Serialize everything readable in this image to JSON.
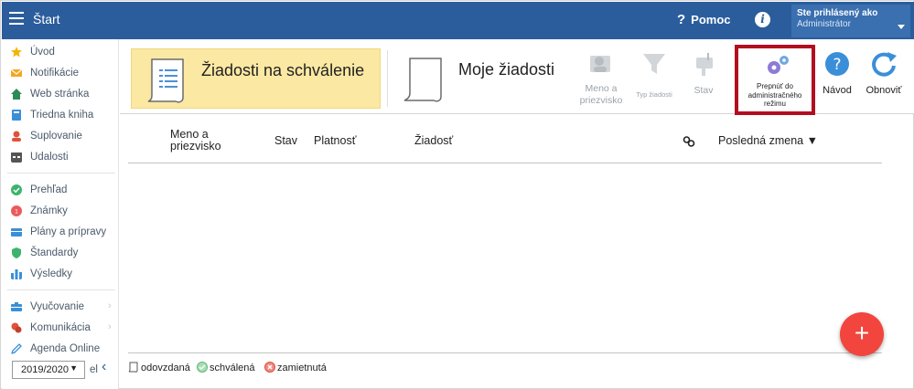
{
  "header": {
    "app_title": "Štart",
    "help_label": "Pomoc",
    "help_symbol": "?",
    "info_symbol": "i",
    "user_line1": "Ste prihlásený ako",
    "user_line2": "Administrátor",
    "bar_color": "#2b5d9c"
  },
  "sidebar": {
    "items": [
      {
        "label": "Úvod",
        "icon": "star-icon",
        "color": "#f4b400"
      },
      {
        "label": "Notifikácie",
        "icon": "envelope-icon",
        "color": "#f5a623"
      },
      {
        "label": "Web stránka",
        "icon": "home-icon",
        "color": "#2e8b57"
      },
      {
        "label": "Triedna kniha",
        "icon": "book-icon",
        "color": "#3a8fd8"
      },
      {
        "label": "Suplovanie",
        "icon": "person-swap-icon",
        "color": "#e0533b"
      },
      {
        "label": "Udalosti",
        "icon": "calendar-icon",
        "color": "#555555"
      },
      {
        "label": "Prehľad",
        "icon": "check-circle-icon",
        "color": "#3cb46e"
      },
      {
        "label": "Známky",
        "icon": "grade-icon",
        "color": "#ea5b5b"
      },
      {
        "label": "Plány a prípravy",
        "icon": "plan-icon",
        "color": "#3a8fd8"
      },
      {
        "label": "Štandardy",
        "icon": "shield-icon",
        "color": "#3cb46e"
      },
      {
        "label": "Výsledky",
        "icon": "bar-chart-icon",
        "color": "#3a8fd8"
      },
      {
        "label": "Vyučovanie",
        "icon": "briefcase-icon",
        "color": "#3a8fd8"
      },
      {
        "label": "Komunikácia",
        "icon": "chat-icon",
        "color": "#e0533b"
      },
      {
        "label": "Agenda Online",
        "icon": "pen-icon",
        "color": "#3a8fd8"
      }
    ],
    "chevron": "›",
    "school_year": "2019/2020",
    "year_caret": "▼",
    "collapse_text": "el",
    "collapse_chevron": "‹"
  },
  "toolbar": {
    "tab_pending": "Žiadosti na schválenie",
    "tab_mine": "Moje žiadosti",
    "tools": {
      "name_label_1": "Meno a",
      "name_label_2": "priezvisko",
      "type_label": "Typ žiadosti",
      "state_label": "Stav",
      "admin_label_1": "Prepnúť do",
      "admin_label_2": "administračného",
      "admin_label_3": "režimu",
      "guide_label": "Návod",
      "refresh_label": "Obnoviť"
    },
    "highlight_color": "#fbe8a3",
    "admin_border_color": "#b30e1f"
  },
  "table": {
    "col_name_1": "Meno a",
    "col_name_2": "priezvisko",
    "col_state": "Stav",
    "col_validity": "Platnosť",
    "col_request": "Žiadosť",
    "col_last_change": "Posledná zmena ▼"
  },
  "legend": {
    "sent": "odovzdaná",
    "approved": "schválená",
    "rejected": "zamietnutá"
  },
  "fab": {
    "label": "+",
    "color": "#f2453d"
  }
}
